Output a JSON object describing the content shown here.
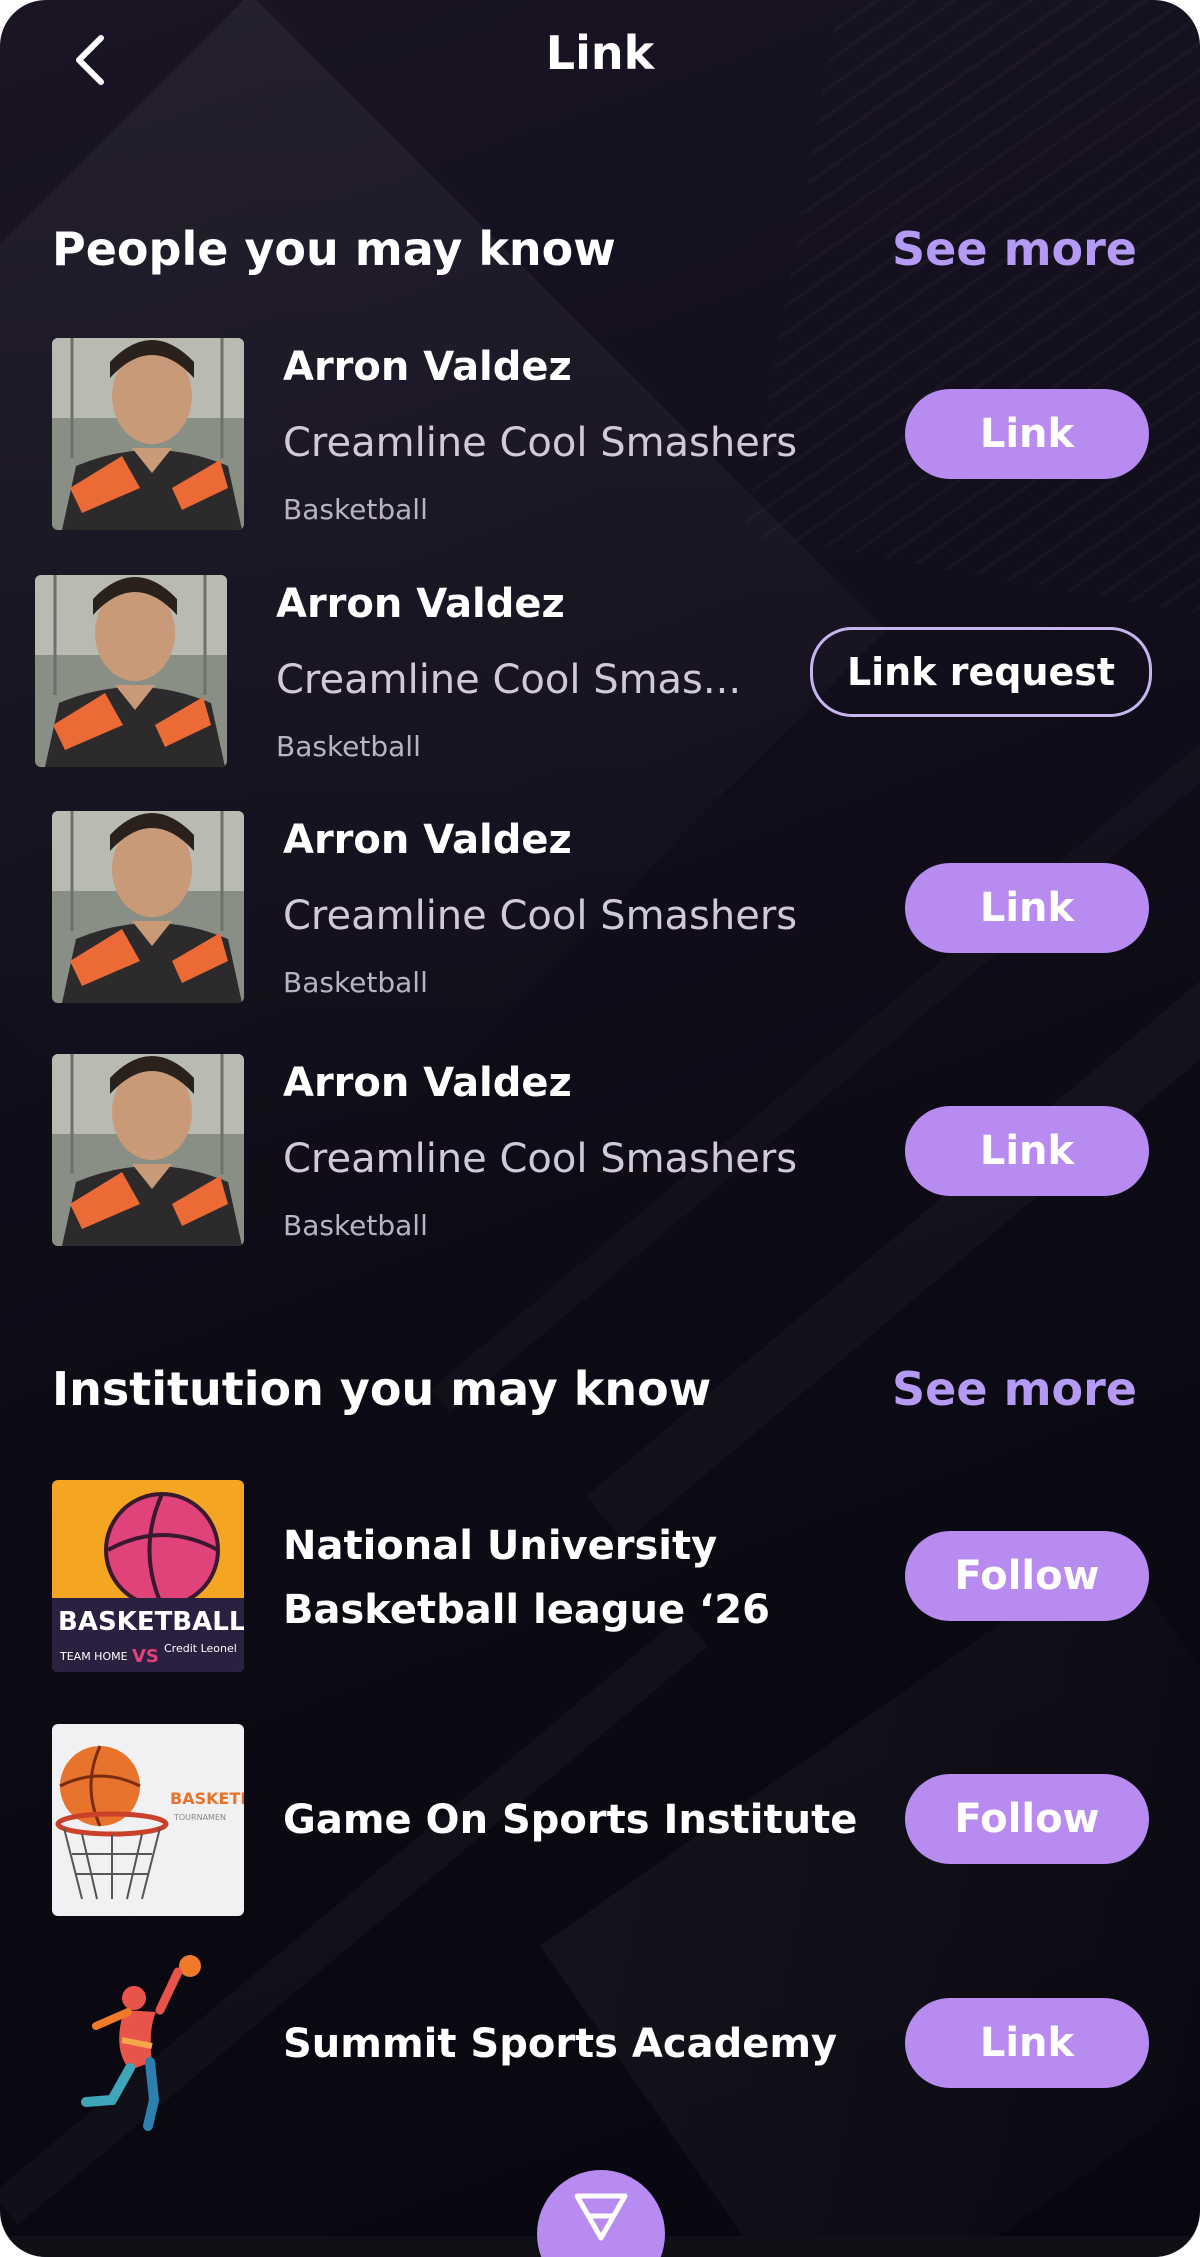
{
  "header": {
    "title": "Link",
    "back_icon": "chevron-left-icon"
  },
  "people_section": {
    "title": "People you may know",
    "see_more": "See more",
    "items": [
      {
        "name": "Arron Valdez",
        "team": "Creamline Cool Smashers",
        "sport": "Basketball",
        "action": "Link",
        "action_style": "filled"
      },
      {
        "name": "Arron Valdez",
        "team": "Creamline Cool Smas...",
        "sport": "Basketball",
        "action": "Link request",
        "action_style": "outline"
      },
      {
        "name": "Arron Valdez",
        "team": "Creamline Cool Smashers",
        "sport": "Basketball",
        "action": "Link",
        "action_style": "filled"
      },
      {
        "name": "Arron Valdez",
        "team": "Creamline Cool Smashers",
        "sport": "Basketball",
        "action": "Link",
        "action_style": "filled"
      }
    ]
  },
  "institution_section": {
    "title": "Institution you may know",
    "see_more": "See more",
    "items": [
      {
        "name_line1": "National University",
        "name_line2": "Basketball league ‘26",
        "action": "Follow",
        "logo": "basketball-tournament-poster",
        "logo_text": {
          "main": "BASKETBALL",
          "sub_left": "TEAM HOME",
          "vs": "VS",
          "sub_right": "Credit Leonel"
        }
      },
      {
        "name": "Game On Sports Institute",
        "action": "Follow",
        "logo": "basketball-hoop-poster",
        "logo_text": {
          "main": "BASKETB",
          "sub": "TOURNAMEN"
        }
      },
      {
        "name": "Summit Sports Academy",
        "action": "Link",
        "logo": "volleyball-player-silhouette"
      }
    ]
  },
  "fab": {
    "icon": "triangle-logo-icon"
  },
  "colors": {
    "accent": "#b78bef",
    "see_more": "#b49af2",
    "background": "#120e1c"
  }
}
